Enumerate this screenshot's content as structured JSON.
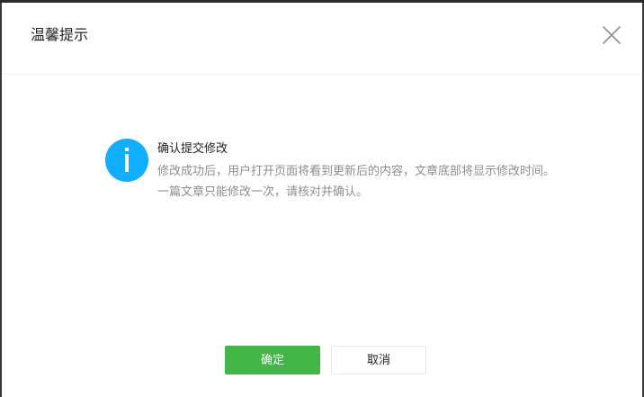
{
  "dialog": {
    "title": "温馨提示",
    "close_icon": "close-icon",
    "message": {
      "icon": "info-icon",
      "title": "确认提交修改",
      "body": "修改成功后，用户打开页面将看到更新后的内容，文章底部将显示修改时间。一篇文章只能修改一次，请核对并确认。"
    },
    "buttons": {
      "confirm_label": "确定",
      "cancel_label": "取消"
    }
  },
  "colors": {
    "primary": "#44b549",
    "info": "#10aeff",
    "text": "#222222",
    "muted": "#8d8d8d"
  }
}
